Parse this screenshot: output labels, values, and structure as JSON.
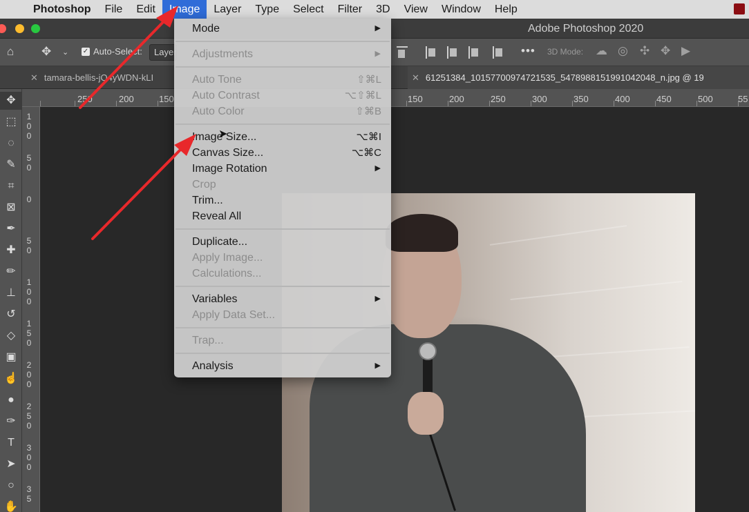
{
  "menubar": {
    "app_name": "Photoshop",
    "items": [
      "File",
      "Edit",
      "Image",
      "Layer",
      "Type",
      "Select",
      "Filter",
      "3D",
      "View",
      "Window",
      "Help"
    ],
    "active": "Image"
  },
  "window": {
    "title": "Adobe Photoshop 2020"
  },
  "options_bar": {
    "auto_select_label": "Auto-Select:",
    "layer_select_value": "Layer",
    "mode_3d_label": "3D Mode:"
  },
  "tabs": [
    {
      "label": "tamara-bellis-jQ4yWDN-kLI",
      "active": false
    },
    {
      "label": "61251384_10157700974721535_5478988151991042048_n.jpg @ 19",
      "active": true
    }
  ],
  "ruler": {
    "top_ticks": [
      "250",
      "200",
      "150",
      "150",
      "200",
      "250",
      "300",
      "350",
      "400",
      "450",
      "500",
      "55"
    ],
    "left_ticks": [
      [
        "1",
        "0",
        "0"
      ],
      [
        "5",
        "0"
      ],
      [
        "0"
      ],
      [
        "5",
        "0"
      ],
      [
        "1",
        "0",
        "0"
      ],
      [
        "1",
        "5",
        "0"
      ],
      [
        "2",
        "0",
        "0"
      ],
      [
        "2",
        "5",
        "0"
      ],
      [
        "3",
        "0",
        "0"
      ],
      [
        "3",
        "5"
      ]
    ]
  },
  "image_menu": {
    "sections": [
      [
        {
          "label": "Mode",
          "submenu": true,
          "disabled": false
        }
      ],
      [
        {
          "label": "Adjustments",
          "submenu": true,
          "disabled": true
        }
      ],
      [
        {
          "label": "Auto Tone",
          "shortcut": "⇧⌘L",
          "disabled": true
        },
        {
          "label": "Auto Contrast",
          "shortcut": "⌥⇧⌘L",
          "disabled": true
        },
        {
          "label": "Auto Color",
          "shortcut": "⇧⌘B",
          "disabled": true
        }
      ],
      [
        {
          "label": "Image Size...",
          "shortcut": "⌥⌘I",
          "disabled": false
        },
        {
          "label": "Canvas Size...",
          "shortcut": "⌥⌘C",
          "disabled": false
        },
        {
          "label": "Image Rotation",
          "submenu": true,
          "disabled": false
        },
        {
          "label": "Crop",
          "disabled": true
        },
        {
          "label": "Trim...",
          "disabled": false
        },
        {
          "label": "Reveal All",
          "disabled": false
        }
      ],
      [
        {
          "label": "Duplicate...",
          "disabled": false
        },
        {
          "label": "Apply Image...",
          "disabled": true
        },
        {
          "label": "Calculations...",
          "disabled": true
        }
      ],
      [
        {
          "label": "Variables",
          "submenu": true,
          "disabled": false
        },
        {
          "label": "Apply Data Set...",
          "disabled": true
        }
      ],
      [
        {
          "label": "Trap...",
          "disabled": true
        }
      ],
      [
        {
          "label": "Analysis",
          "submenu": true,
          "disabled": false
        }
      ]
    ]
  },
  "colors": {
    "menu_highlight": "#2f6cd8",
    "annotation_arrow": "#e8282b"
  },
  "icons": [
    "apple-icon",
    "home-icon",
    "move-icon",
    "marquee-icon",
    "lasso-icon",
    "quick-select-icon",
    "crop-icon",
    "frame-icon",
    "eyedropper-icon",
    "healing-brush-icon",
    "brush-icon",
    "stamp-icon",
    "history-brush-icon",
    "eraser-icon",
    "gradient-icon",
    "smudge-icon",
    "dodge-icon",
    "pen-icon",
    "type-icon",
    "path-select-icon",
    "ellipse-icon",
    "hand-icon"
  ]
}
